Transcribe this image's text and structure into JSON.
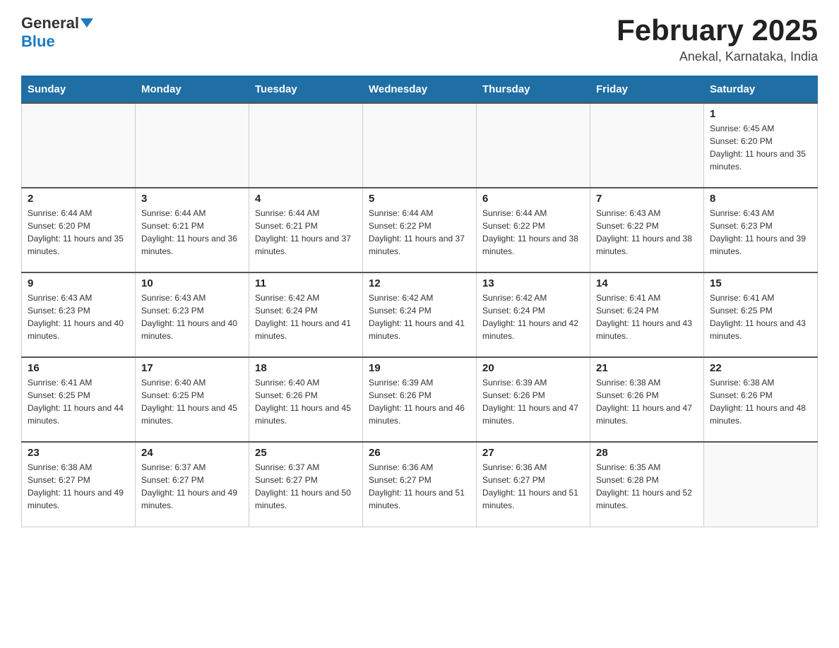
{
  "header": {
    "logo_general": "General",
    "logo_blue": "Blue",
    "month_title": "February 2025",
    "location": "Anekal, Karnataka, India"
  },
  "weekdays": [
    "Sunday",
    "Monday",
    "Tuesday",
    "Wednesday",
    "Thursday",
    "Friday",
    "Saturday"
  ],
  "weeks": [
    [
      {
        "day": "",
        "info": ""
      },
      {
        "day": "",
        "info": ""
      },
      {
        "day": "",
        "info": ""
      },
      {
        "day": "",
        "info": ""
      },
      {
        "day": "",
        "info": ""
      },
      {
        "day": "",
        "info": ""
      },
      {
        "day": "1",
        "info": "Sunrise: 6:45 AM\nSunset: 6:20 PM\nDaylight: 11 hours and 35 minutes."
      }
    ],
    [
      {
        "day": "2",
        "info": "Sunrise: 6:44 AM\nSunset: 6:20 PM\nDaylight: 11 hours and 35 minutes."
      },
      {
        "day": "3",
        "info": "Sunrise: 6:44 AM\nSunset: 6:21 PM\nDaylight: 11 hours and 36 minutes."
      },
      {
        "day": "4",
        "info": "Sunrise: 6:44 AM\nSunset: 6:21 PM\nDaylight: 11 hours and 37 minutes."
      },
      {
        "day": "5",
        "info": "Sunrise: 6:44 AM\nSunset: 6:22 PM\nDaylight: 11 hours and 37 minutes."
      },
      {
        "day": "6",
        "info": "Sunrise: 6:44 AM\nSunset: 6:22 PM\nDaylight: 11 hours and 38 minutes."
      },
      {
        "day": "7",
        "info": "Sunrise: 6:43 AM\nSunset: 6:22 PM\nDaylight: 11 hours and 38 minutes."
      },
      {
        "day": "8",
        "info": "Sunrise: 6:43 AM\nSunset: 6:23 PM\nDaylight: 11 hours and 39 minutes."
      }
    ],
    [
      {
        "day": "9",
        "info": "Sunrise: 6:43 AM\nSunset: 6:23 PM\nDaylight: 11 hours and 40 minutes."
      },
      {
        "day": "10",
        "info": "Sunrise: 6:43 AM\nSunset: 6:23 PM\nDaylight: 11 hours and 40 minutes."
      },
      {
        "day": "11",
        "info": "Sunrise: 6:42 AM\nSunset: 6:24 PM\nDaylight: 11 hours and 41 minutes."
      },
      {
        "day": "12",
        "info": "Sunrise: 6:42 AM\nSunset: 6:24 PM\nDaylight: 11 hours and 41 minutes."
      },
      {
        "day": "13",
        "info": "Sunrise: 6:42 AM\nSunset: 6:24 PM\nDaylight: 11 hours and 42 minutes."
      },
      {
        "day": "14",
        "info": "Sunrise: 6:41 AM\nSunset: 6:24 PM\nDaylight: 11 hours and 43 minutes."
      },
      {
        "day": "15",
        "info": "Sunrise: 6:41 AM\nSunset: 6:25 PM\nDaylight: 11 hours and 43 minutes."
      }
    ],
    [
      {
        "day": "16",
        "info": "Sunrise: 6:41 AM\nSunset: 6:25 PM\nDaylight: 11 hours and 44 minutes."
      },
      {
        "day": "17",
        "info": "Sunrise: 6:40 AM\nSunset: 6:25 PM\nDaylight: 11 hours and 45 minutes."
      },
      {
        "day": "18",
        "info": "Sunrise: 6:40 AM\nSunset: 6:26 PM\nDaylight: 11 hours and 45 minutes."
      },
      {
        "day": "19",
        "info": "Sunrise: 6:39 AM\nSunset: 6:26 PM\nDaylight: 11 hours and 46 minutes."
      },
      {
        "day": "20",
        "info": "Sunrise: 6:39 AM\nSunset: 6:26 PM\nDaylight: 11 hours and 47 minutes."
      },
      {
        "day": "21",
        "info": "Sunrise: 6:38 AM\nSunset: 6:26 PM\nDaylight: 11 hours and 47 minutes."
      },
      {
        "day": "22",
        "info": "Sunrise: 6:38 AM\nSunset: 6:26 PM\nDaylight: 11 hours and 48 minutes."
      }
    ],
    [
      {
        "day": "23",
        "info": "Sunrise: 6:38 AM\nSunset: 6:27 PM\nDaylight: 11 hours and 49 minutes."
      },
      {
        "day": "24",
        "info": "Sunrise: 6:37 AM\nSunset: 6:27 PM\nDaylight: 11 hours and 49 minutes."
      },
      {
        "day": "25",
        "info": "Sunrise: 6:37 AM\nSunset: 6:27 PM\nDaylight: 11 hours and 50 minutes."
      },
      {
        "day": "26",
        "info": "Sunrise: 6:36 AM\nSunset: 6:27 PM\nDaylight: 11 hours and 51 minutes."
      },
      {
        "day": "27",
        "info": "Sunrise: 6:36 AM\nSunset: 6:27 PM\nDaylight: 11 hours and 51 minutes."
      },
      {
        "day": "28",
        "info": "Sunrise: 6:35 AM\nSunset: 6:28 PM\nDaylight: 11 hours and 52 minutes."
      },
      {
        "day": "",
        "info": ""
      }
    ]
  ]
}
